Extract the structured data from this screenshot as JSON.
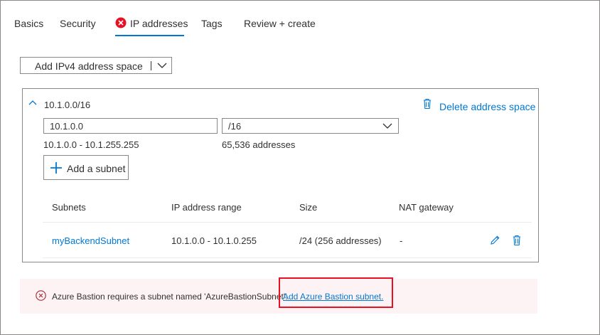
{
  "tabs": [
    {
      "label": "Basics"
    },
    {
      "label": "Security"
    },
    {
      "label": "IP addresses"
    },
    {
      "label": "Tags"
    },
    {
      "label": "Review + create"
    }
  ],
  "add_space": {
    "label": "Add IPv4 address space"
  },
  "address_space": {
    "title": "10.1.0.0/16",
    "delete_label": "Delete address space",
    "address_value": "10.1.0.0",
    "prefix_value": "/16",
    "range_text": "10.1.0.0 - 10.1.255.255",
    "count_text": "65,536 addresses",
    "add_subnet_label": "Add a subnet"
  },
  "subnets_table": {
    "headers": [
      "Subnets",
      "IP address range",
      "Size",
      "NAT gateway"
    ],
    "rows": [
      {
        "name": "myBackendSubnet",
        "range": "10.1.0.0 - 10.1.0.255",
        "size": "/24 (256 addresses)",
        "nat": "-"
      }
    ]
  },
  "error": {
    "message": "Azure Bastion requires a subnet named 'AzureBastionSubnet'.",
    "link": "Add Azure Bastion subnet."
  },
  "colors": {
    "accent": "#0078d4",
    "error": "#e81123",
    "error_bg": "#fdf3f4"
  }
}
